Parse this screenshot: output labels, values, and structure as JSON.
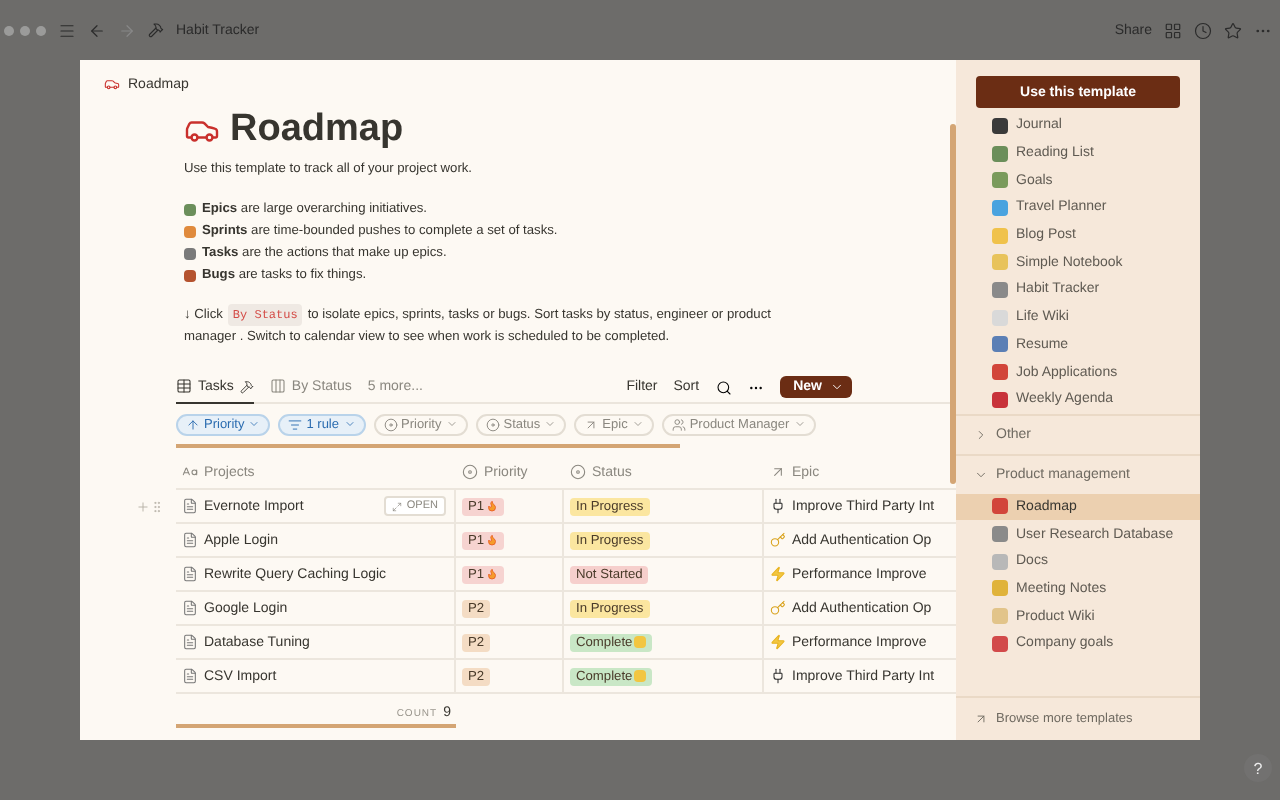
{
  "app_bar": {
    "title": "Habit Tracker",
    "share": "Share"
  },
  "page": {
    "breadcrumb": "Roadmap",
    "title": "Roadmap",
    "intro": "Use this template to track all of your project work.",
    "definitions": [
      "**Epics** are large overarching initiatives.",
      "**Sprints** are time-bounded pushes to complete a set of tasks.",
      "**Tasks** are the actions that make up epics.",
      "**Bugs** are tasks to fix things."
    ],
    "hint": {
      "lead": "↓ Click",
      "code": "By Status",
      "rest": "to isolate epics, sprints, tasks or bugs. Sort tasks by status, engineer or product",
      "continuation": "manager . Switch to calendar view to see when work is scheduled to be completed."
    }
  },
  "views": {
    "tabs": [
      {
        "label": "Tasks",
        "kind": "table",
        "selected": true
      },
      {
        "label": "By Status",
        "kind": "board",
        "selected": false
      },
      {
        "label": "5 more...",
        "kind": "more",
        "selected": false
      }
    ],
    "filter": "Filter",
    "sort": "Sort",
    "new_button": "New"
  },
  "chips": [
    {
      "label": "Priority",
      "kind": "sort"
    },
    {
      "label": "1 rule",
      "kind": "filter"
    },
    {
      "label": "Priority",
      "kind": "select"
    },
    {
      "label": "Status",
      "kind": "select"
    },
    {
      "label": "Epic",
      "kind": "relation"
    },
    {
      "label": "Product Manager",
      "kind": "person"
    }
  ],
  "table": {
    "columns": [
      {
        "label": "Projects",
        "kind": "title"
      },
      {
        "label": "Priority",
        "kind": "select"
      },
      {
        "label": "Status",
        "kind": "select"
      },
      {
        "label": "Epic",
        "kind": "relation"
      }
    ],
    "rows": [
      {
        "name": "Evernote Import",
        "open_button": "OPEN",
        "priority": {
          "text": "P1",
          "color": "#f6d3d0",
          "hot": true
        },
        "status": {
          "text": "In Progress",
          "color": "#fbe6a0",
          "celebrate": false
        },
        "epic": {
          "text": "Improve Third Party Int",
          "kind": "plug"
        }
      },
      {
        "name": "Apple Login",
        "priority": {
          "text": "P1",
          "color": "#f6d3d0",
          "hot": true
        },
        "status": {
          "text": "In Progress",
          "color": "#fbe6a0",
          "celebrate": false
        },
        "epic": {
          "text": "Add Authentication Op",
          "kind": "key"
        }
      },
      {
        "name": "Rewrite Query Caching Logic",
        "priority": {
          "text": "P1",
          "color": "#f6d3d0",
          "hot": true
        },
        "status": {
          "text": "Not Started",
          "color": "#f6cfcc",
          "celebrate": false
        },
        "epic": {
          "text": "Performance Improve",
          "kind": "bolt"
        }
      },
      {
        "name": "Google Login",
        "priority": {
          "text": "P2",
          "color": "#f4dcc4",
          "hot": false
        },
        "status": {
          "text": "In Progress",
          "color": "#fbe6a0",
          "celebrate": false
        },
        "epic": {
          "text": "Add Authentication Op",
          "kind": "key"
        }
      },
      {
        "name": "Database Tuning",
        "priority": {
          "text": "P2",
          "color": "#f4dcc4",
          "hot": false
        },
        "status": {
          "text": "Complete",
          "color": "#c9e7c6",
          "celebrate": true
        },
        "epic": {
          "text": "Performance Improve",
          "kind": "bolt"
        }
      },
      {
        "name": "CSV Import",
        "priority": {
          "text": "P2",
          "color": "#f4dcc4",
          "hot": false
        },
        "status": {
          "text": "Complete",
          "color": "#c9e7c6",
          "celebrate": true
        },
        "epic": {
          "text": "Improve Third Party Int",
          "kind": "plug"
        }
      }
    ],
    "count_label": "COUNT",
    "count": "9"
  },
  "templates": {
    "button": "Use this template",
    "items": [
      {
        "label": "Journal",
        "selected": false
      },
      {
        "label": "Reading List",
        "selected": false
      },
      {
        "label": "Goals",
        "selected": false
      },
      {
        "label": "Travel Planner",
        "selected": false
      },
      {
        "label": "Blog Post",
        "selected": false
      },
      {
        "label": "Simple Notebook",
        "selected": false
      },
      {
        "label": "Habit Tracker",
        "selected": false
      },
      {
        "label": "Life Wiki",
        "selected": false
      },
      {
        "label": "Resume",
        "selected": false
      },
      {
        "label": "Job Applications",
        "selected": false
      },
      {
        "label": "Weekly Agenda",
        "selected": false
      }
    ],
    "sections": [
      {
        "label": "Other",
        "expanded": false
      },
      {
        "label": "Product management",
        "expanded": true,
        "items": [
          {
            "label": "Roadmap",
            "selected": true
          },
          {
            "label": "User Research Database",
            "selected": false
          },
          {
            "label": "Docs",
            "selected": false
          },
          {
            "label": "Meeting Notes",
            "selected": false
          },
          {
            "label": "Product Wiki",
            "selected": false
          },
          {
            "label": "Company goals",
            "selected": false
          }
        ]
      }
    ],
    "browse": "Browse more templates"
  },
  "help": "?"
}
